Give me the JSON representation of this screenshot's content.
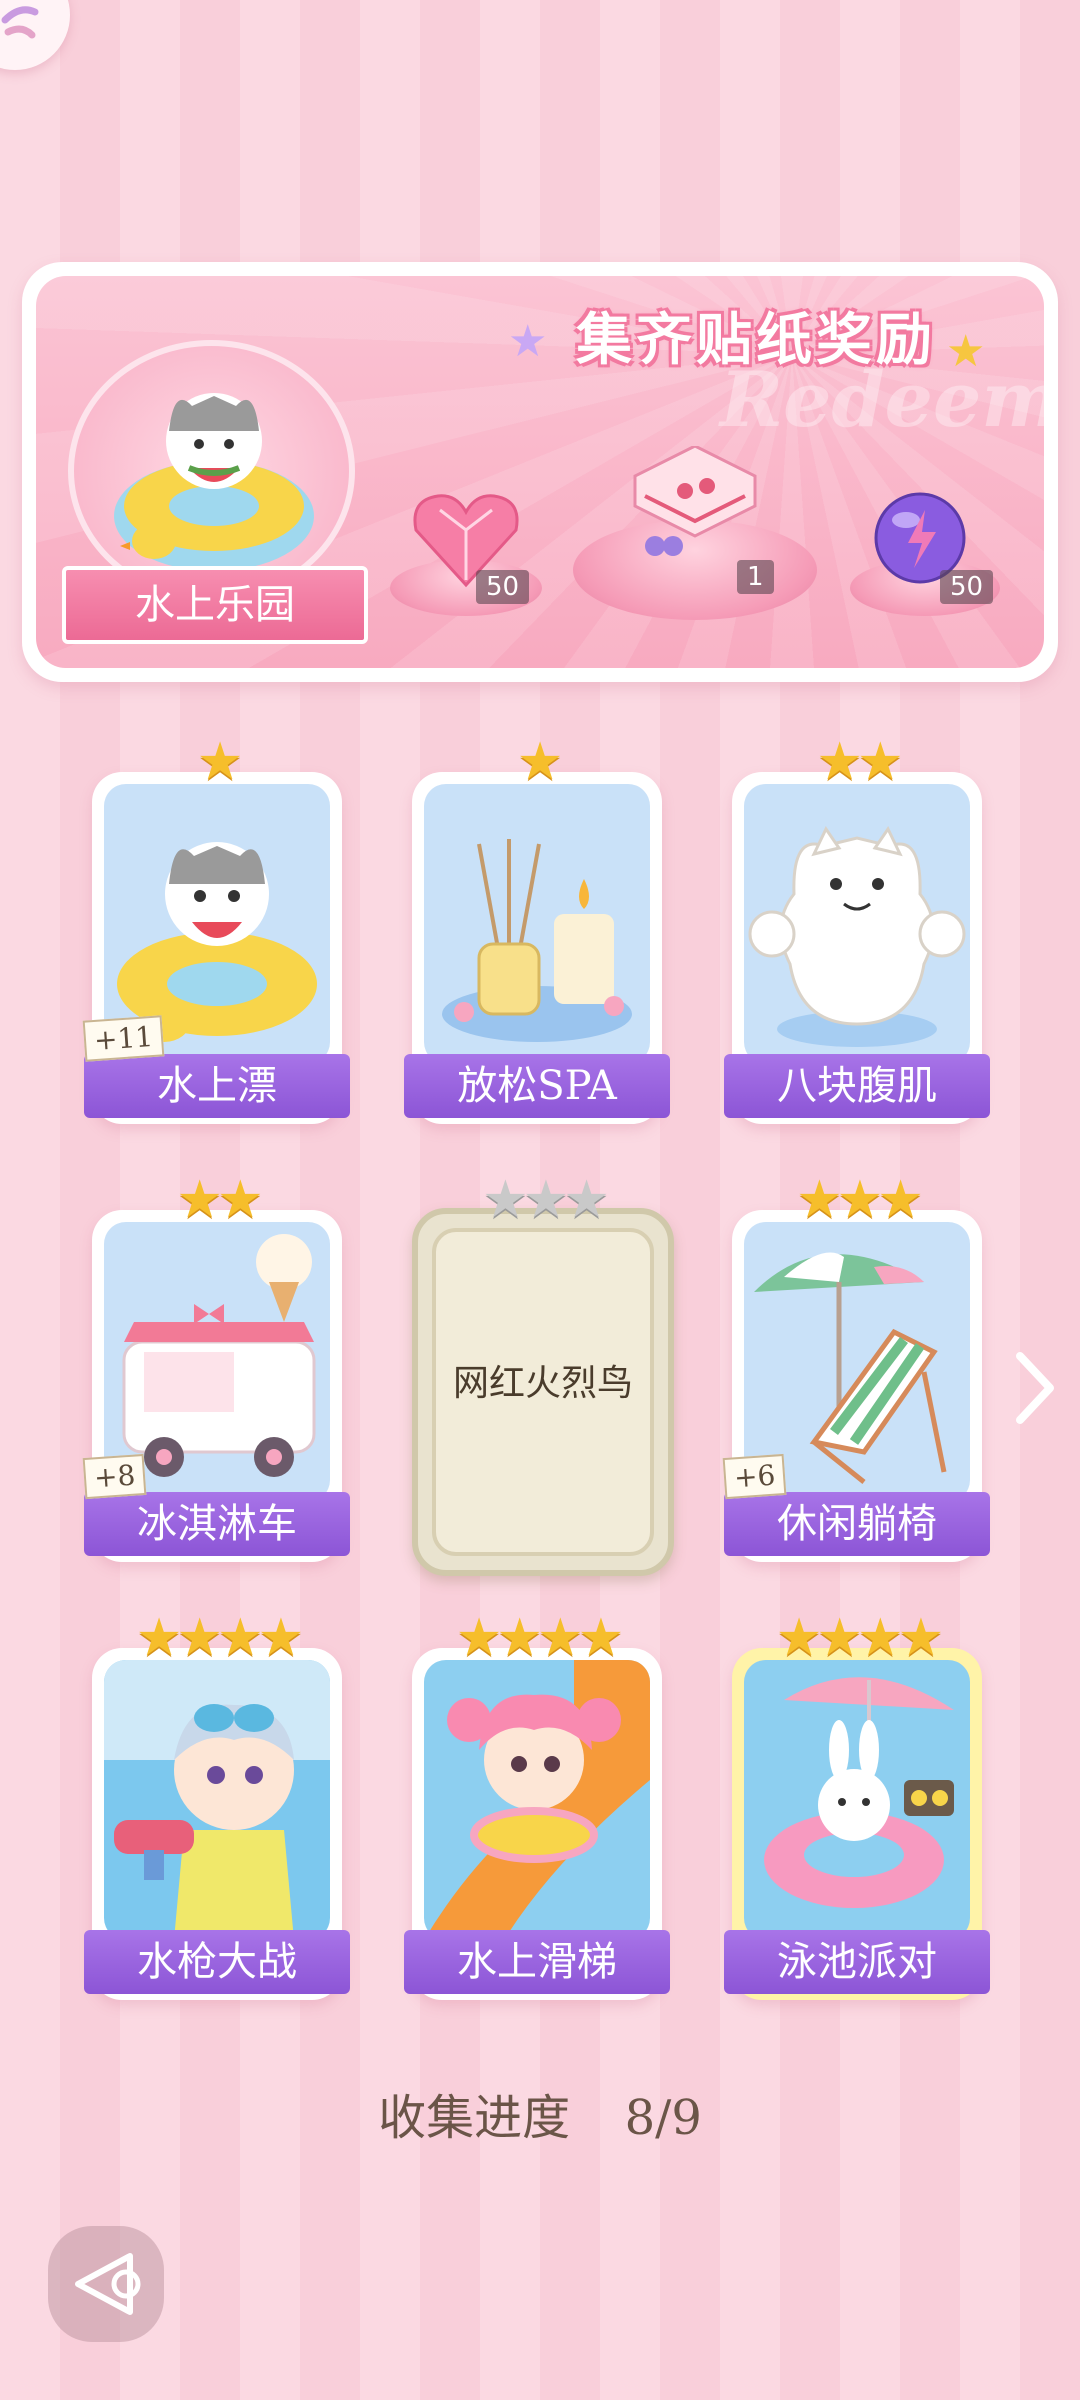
{
  "banner": {
    "title": "集齐贴纸奖励",
    "watermark": "Redeem",
    "park_name": "水上乐园",
    "rewards": [
      {
        "icon": "heart-gem-icon",
        "count": "50"
      },
      {
        "icon": "gift-box-icon",
        "count": "1"
      },
      {
        "icon": "energy-orb-icon",
        "count": "50"
      }
    ]
  },
  "cards": [
    {
      "label": "水上漂",
      "stars": "★",
      "plus": "+11",
      "icon": "cat-swim-ring-icon"
    },
    {
      "label": "放松SPA",
      "stars": "★",
      "plus": "",
      "icon": "spa-candle-icon"
    },
    {
      "label": "八块腹肌",
      "stars": "★★",
      "plus": "",
      "icon": "muscle-cat-icon"
    },
    {
      "label": "冰淇淋车",
      "stars": "★★",
      "plus": "+8",
      "icon": "ice-cream-truck-icon"
    },
    {
      "label": "网红火烈鸟",
      "stars": "★★★",
      "locked": true
    },
    {
      "label": "休闲躺椅",
      "stars": "★★★",
      "plus": "+6",
      "icon": "beach-chair-icon"
    },
    {
      "label": "水枪大战",
      "stars": "★★★★",
      "plus": "",
      "icon": "water-gun-boy-icon"
    },
    {
      "label": "水上滑梯",
      "stars": "★★★★",
      "plus": "",
      "icon": "water-slide-girl-icon"
    },
    {
      "label": "泳池派对",
      "stars": "★★★★",
      "plus": "",
      "icon": "pool-bunny-icon"
    }
  ],
  "progress": {
    "label": "收集进度",
    "value": "8/9"
  },
  "colors": {
    "accent": "#9b63e0",
    "pink": "#f47aa0",
    "star": "#f6be2b"
  }
}
